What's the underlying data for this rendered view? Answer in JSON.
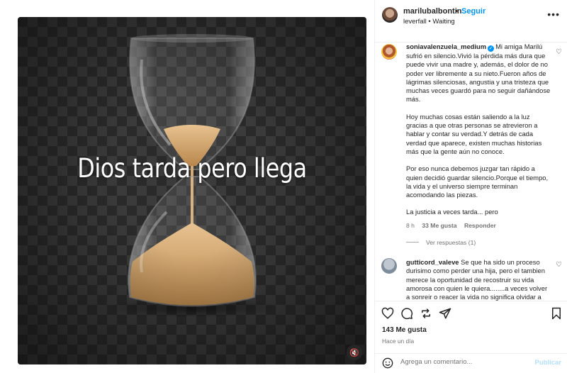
{
  "post": {
    "overlay_text": "Dios tarda pero llega"
  },
  "header": {
    "username": "marilubalbontin",
    "separator": "•",
    "follow_label": "Seguir",
    "audio": "leverfall • Waiting",
    "more_icon": "more-icon"
  },
  "comments": [
    {
      "username": "soniavalenzuela_medium",
      "verified": true,
      "paragraphs": [
        "Mi amiga Marilú sufrió en silencio.Vivió la pérdida más dura que puede vivir una madre y, además, el dolor de no poder ver libremente a su nieto.Fueron años de lágrimas silenciosas, angustia y una tristeza que muchas veces guardó para no seguir dañándose más.",
        "Hoy muchas cosas están saliendo a la luz gracias a que otras personas se atrevieron a hablar y contar su verdad.Y detrás de cada verdad que aparece, existen muchas historias más que la gente aún no conoce.",
        "Por eso nunca debemos juzgar tan rápido a quien decidió guardar silencio.Porque el tiempo, la vida y el universo siempre terminan acomodando las piezas.",
        "La justicia a veces tarda... pero"
      ],
      "time": "8 h",
      "likes": "33 Me gusta",
      "reply_label": "Responder",
      "view_replies": "Ver respuestas (1)"
    },
    {
      "username": "gutticord_valeve",
      "text": "Se que ha sido un proceso durisimo como perder una hija, pero el tambien merece la oportunidad de recostruir su vida amorosa con quien le quiera........a veces volver a sonreir o reacer la vida no significa olvidar a"
    }
  ],
  "footer": {
    "likes": "143 Me gusta",
    "time_ago": "Hace un día",
    "comment_placeholder": "Agrega un comentario...",
    "publish_label": "Publicar"
  },
  "colors": {
    "accent": "#0095f6",
    "muted": "#737373",
    "publish_disabled": "#b2dffc"
  }
}
